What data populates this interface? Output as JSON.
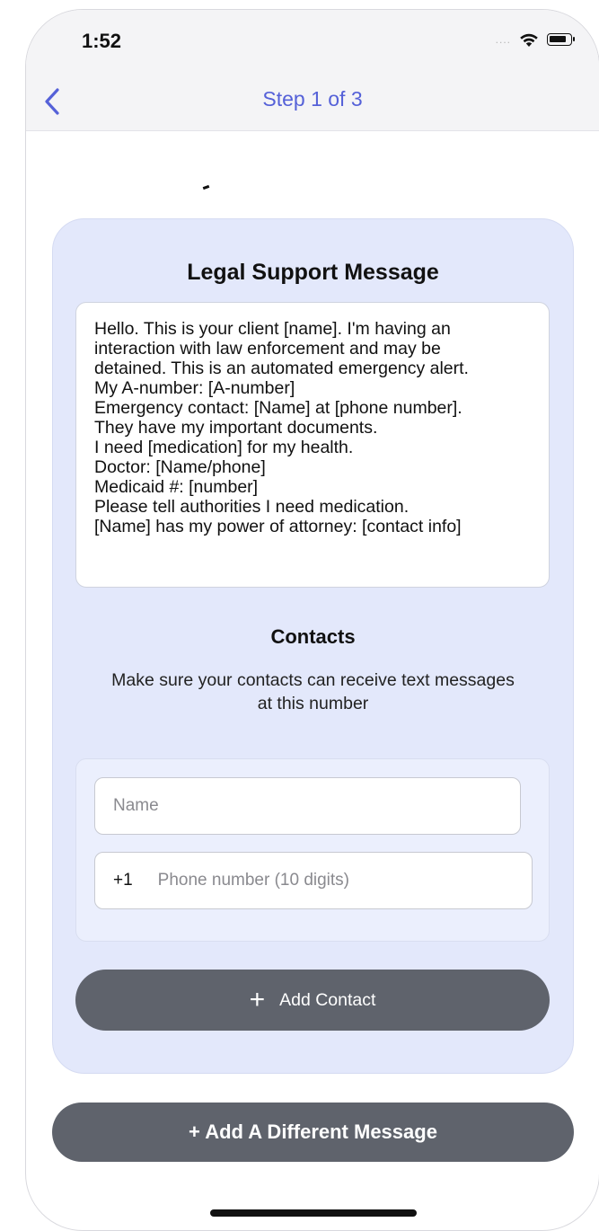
{
  "status_bar": {
    "time": "1:52",
    "signal": "....",
    "wifi_icon": "wifi-icon",
    "battery_icon": "battery-icon"
  },
  "nav": {
    "back_icon": "chevron-left-icon",
    "title": "Step 1 of 3"
  },
  "colors": {
    "accent": "#5561d8",
    "card_bg": "#e3e8fb",
    "button_bg": "#5f636c"
  },
  "card": {
    "title": "Legal Support Message",
    "message_lines": [
      "Hello. This is your client [name]. I'm having an",
      "interaction with law enforcement and may be",
      "detained. This is an automated emergency alert.",
      "My A-number: [A-number]",
      "Emergency contact: [Name] at [phone number].",
      "They have my important documents.",
      "I need [medication] for my health.",
      "Doctor: [Name/phone]",
      "Medicaid #: [number]",
      "Please tell authorities I need medication.",
      "[Name] has my power of attorney: [contact info]"
    ],
    "contacts_title": "Contacts",
    "contacts_subtitle_line1": "Make sure your contacts can receive text messages",
    "contacts_subtitle_line2": "at this number",
    "name_placeholder": "Name",
    "name_value": "",
    "country_code": "+1",
    "phone_placeholder": "Phone number (10 digits)",
    "phone_value": "",
    "add_contact_icon": "plus-icon",
    "add_contact_plus": "+",
    "add_contact_label": "Add Contact"
  },
  "footer": {
    "add_message_label": "+ Add A Different Message"
  }
}
